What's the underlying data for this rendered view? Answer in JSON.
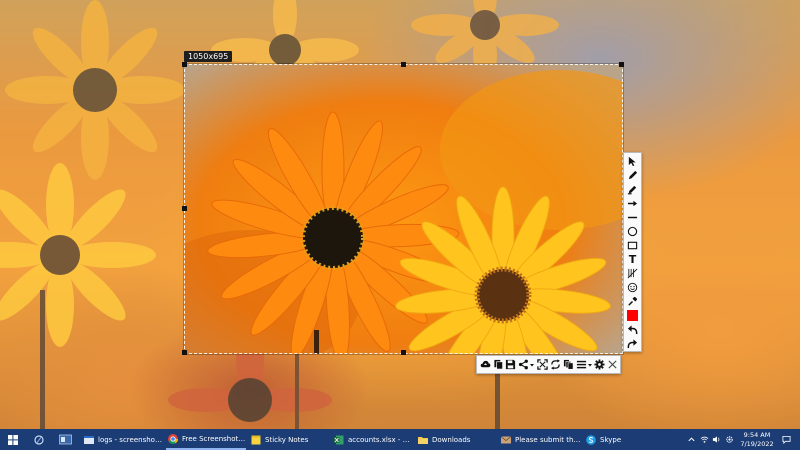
{
  "screenshot_tool": {
    "size_label": "1050x695",
    "swatch_color": "#ff0000",
    "draw_tools": [
      "cursor-icon",
      "pen-icon",
      "marker-icon",
      "arrow-icon",
      "line-icon",
      "ellipse-icon",
      "rectangle-icon",
      "text-tool-icon",
      "blur-icon",
      "emoji-icon",
      "color-picker-icon",
      "color-swatch",
      "undo-icon",
      "redo-icon"
    ],
    "text_tool_glyph": "T",
    "actions": [
      "upload-icon",
      "copy-icon",
      "save-icon",
      "share-icon",
      "fullscreen-icon",
      "rotate-icon",
      "copy-all-icon",
      "menu-icon",
      "settings-icon",
      "close-icon"
    ]
  },
  "taskbar": {
    "buttons": [
      {
        "label": "logs - screenshot@f..."
      },
      {
        "label": "Free Screenshot To..."
      },
      {
        "label": "Sticky Notes"
      },
      {
        "label": "accounts.xlsx - Excel"
      },
      {
        "label": "Downloads"
      },
      {
        "label": "Please submit the f..."
      },
      {
        "label": "Skype"
      }
    ],
    "time": "9:54 AM",
    "date": "7/19/2022",
    "accent": "#1b3c74"
  }
}
